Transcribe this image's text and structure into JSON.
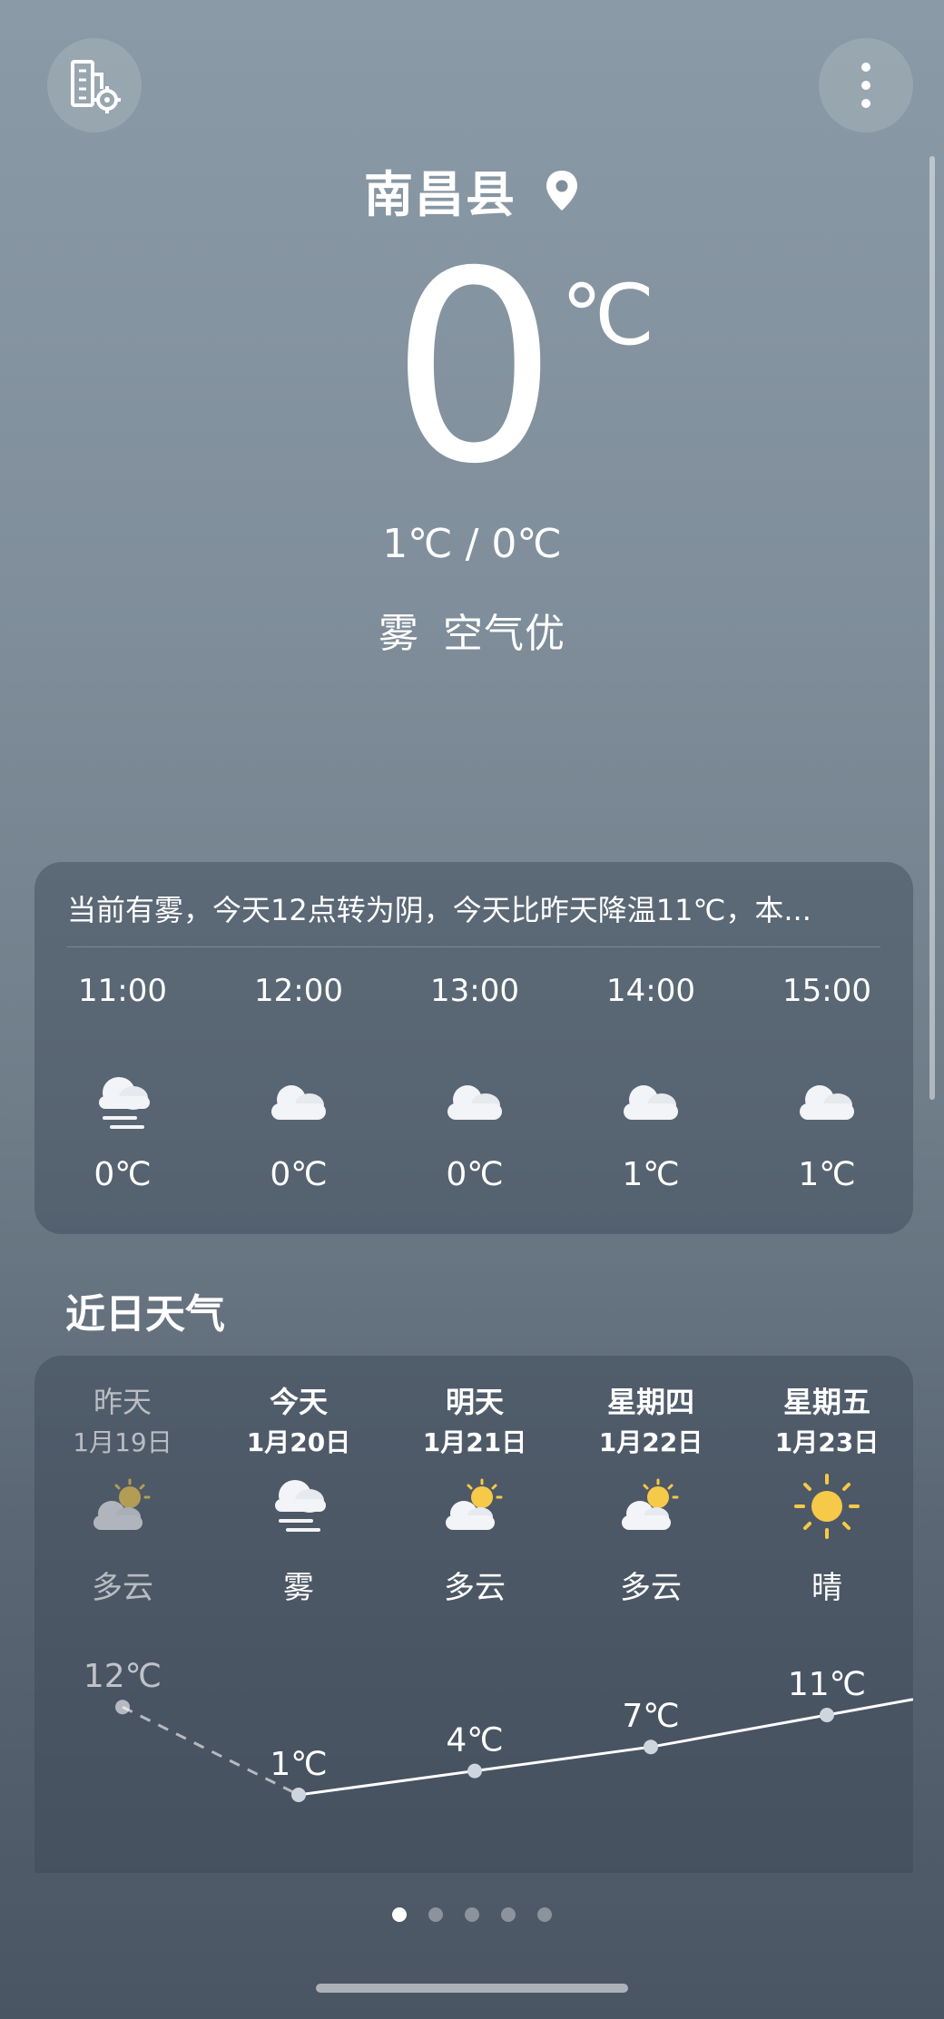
{
  "header": {
    "city": "南昌县",
    "temperature": "0",
    "unit": "℃",
    "range": "1℃ / 0℃",
    "condition": "雾",
    "air_quality": "空气优"
  },
  "hourly": {
    "summary": "当前有雾，今天12点转为阴，今天比昨天降温11℃，本...",
    "items": [
      {
        "time": "11:00",
        "icon": "fog-icon",
        "temp": "0℃"
      },
      {
        "time": "12:00",
        "icon": "cloud-icon",
        "temp": "0℃"
      },
      {
        "time": "13:00",
        "icon": "cloud-icon",
        "temp": "0℃"
      },
      {
        "time": "14:00",
        "icon": "cloud-icon",
        "temp": "1℃"
      },
      {
        "time": "15:00",
        "icon": "cloud-icon",
        "temp": "1℃"
      }
    ]
  },
  "daily": {
    "title": "近日天气",
    "items": [
      {
        "day": "昨天",
        "date": "1月19日",
        "icon": "partly-cloudy-icon",
        "condition": "多云"
      },
      {
        "day": "今天",
        "date": "1月20日",
        "icon": "fog-icon",
        "condition": "雾"
      },
      {
        "day": "明天",
        "date": "1月21日",
        "icon": "partly-cloudy-icon",
        "condition": "多云"
      },
      {
        "day": "星期四",
        "date": "1月22日",
        "icon": "partly-cloudy-icon",
        "condition": "多云"
      },
      {
        "day": "星期五",
        "date": "1月23日",
        "icon": "sunny-icon",
        "condition": "晴"
      }
    ]
  },
  "chart_data": {
    "type": "line",
    "categories": [
      "1月19日",
      "1月20日",
      "1月21日",
      "1月22日",
      "1月23日"
    ],
    "series": [
      {
        "values": [
          12,
          1,
          4,
          7,
          11
        ],
        "labels": [
          "12℃",
          "1℃",
          "4℃",
          "7℃",
          "11℃"
        ]
      }
    ]
  },
  "pager": {
    "count": 5,
    "active": 0
  },
  "colors": {
    "sun": "#f7c948",
    "cloud": "#f2f4f7"
  }
}
